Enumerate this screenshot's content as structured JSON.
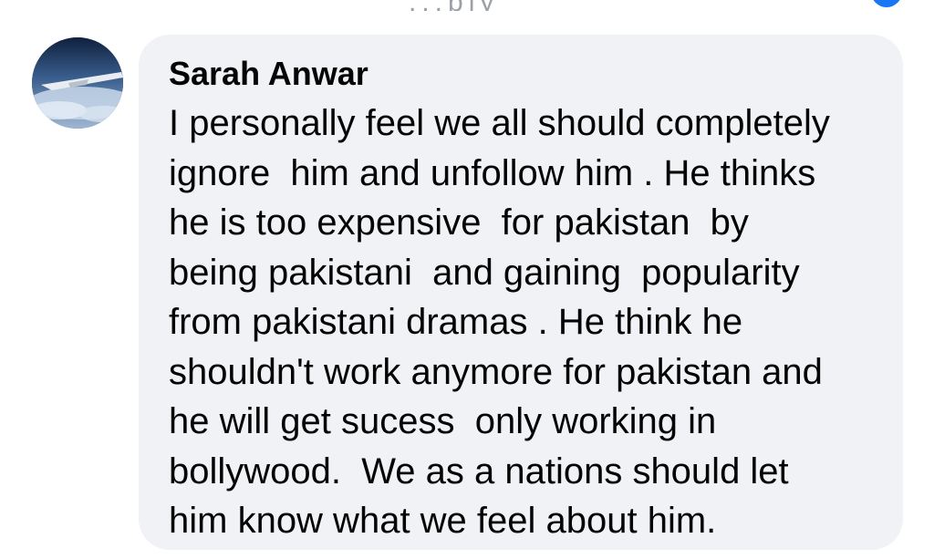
{
  "top_strip": {
    "partial_text": "...ply"
  },
  "comment": {
    "author": "Sarah Anwar",
    "lines": [
      "I personally feel we all should completely",
      "ignore  him and unfollow him . He thinks",
      "he is too expensive  for pakistan  by",
      "being pakistani  and gaining  popularity",
      "from pakistani dramas . He think he",
      "shouldn't work anymore for pakistan and",
      "he will get sucess  only working in",
      "bollywood.  We as a nations should let",
      "him know what we feel about him."
    ]
  },
  "icons": {
    "avatar": "profile-photo-airplane-wing-over-clouds"
  },
  "colors": {
    "bubble_bg": "#f0f2f5",
    "text": "#050505",
    "accent": "#1877f2"
  }
}
